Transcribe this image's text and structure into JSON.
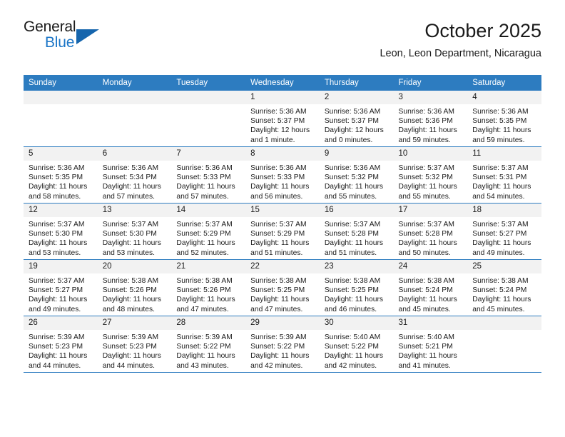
{
  "brand": {
    "name_part1": "General",
    "name_part2": "Blue",
    "accent_color": "#1c76c7",
    "triangle_color": "#1565ad"
  },
  "header": {
    "title": "October 2025",
    "subtitle": "Leon, Leon Department, Nicaragua"
  },
  "calendar": {
    "header_color": "#2d7cc0",
    "daynum_bg": "#f2f2f2",
    "weekday_headers": [
      "Sunday",
      "Monday",
      "Tuesday",
      "Wednesday",
      "Thursday",
      "Friday",
      "Saturday"
    ],
    "weeks": [
      [
        {
          "blank": true
        },
        {
          "blank": true
        },
        {
          "blank": true
        },
        {
          "day": "1",
          "sunrise": "Sunrise: 5:36 AM",
          "sunset": "Sunset: 5:37 PM",
          "daylight": "Daylight: 12 hours and 1 minute."
        },
        {
          "day": "2",
          "sunrise": "Sunrise: 5:36 AM",
          "sunset": "Sunset: 5:37 PM",
          "daylight": "Daylight: 12 hours and 0 minutes."
        },
        {
          "day": "3",
          "sunrise": "Sunrise: 5:36 AM",
          "sunset": "Sunset: 5:36 PM",
          "daylight": "Daylight: 11 hours and 59 minutes."
        },
        {
          "day": "4",
          "sunrise": "Sunrise: 5:36 AM",
          "sunset": "Sunset: 5:35 PM",
          "daylight": "Daylight: 11 hours and 59 minutes."
        }
      ],
      [
        {
          "day": "5",
          "sunrise": "Sunrise: 5:36 AM",
          "sunset": "Sunset: 5:35 PM",
          "daylight": "Daylight: 11 hours and 58 minutes."
        },
        {
          "day": "6",
          "sunrise": "Sunrise: 5:36 AM",
          "sunset": "Sunset: 5:34 PM",
          "daylight": "Daylight: 11 hours and 57 minutes."
        },
        {
          "day": "7",
          "sunrise": "Sunrise: 5:36 AM",
          "sunset": "Sunset: 5:33 PM",
          "daylight": "Daylight: 11 hours and 57 minutes."
        },
        {
          "day": "8",
          "sunrise": "Sunrise: 5:36 AM",
          "sunset": "Sunset: 5:33 PM",
          "daylight": "Daylight: 11 hours and 56 minutes."
        },
        {
          "day": "9",
          "sunrise": "Sunrise: 5:36 AM",
          "sunset": "Sunset: 5:32 PM",
          "daylight": "Daylight: 11 hours and 55 minutes."
        },
        {
          "day": "10",
          "sunrise": "Sunrise: 5:37 AM",
          "sunset": "Sunset: 5:32 PM",
          "daylight": "Daylight: 11 hours and 55 minutes."
        },
        {
          "day": "11",
          "sunrise": "Sunrise: 5:37 AM",
          "sunset": "Sunset: 5:31 PM",
          "daylight": "Daylight: 11 hours and 54 minutes."
        }
      ],
      [
        {
          "day": "12",
          "sunrise": "Sunrise: 5:37 AM",
          "sunset": "Sunset: 5:30 PM",
          "daylight": "Daylight: 11 hours and 53 minutes."
        },
        {
          "day": "13",
          "sunrise": "Sunrise: 5:37 AM",
          "sunset": "Sunset: 5:30 PM",
          "daylight": "Daylight: 11 hours and 53 minutes."
        },
        {
          "day": "14",
          "sunrise": "Sunrise: 5:37 AM",
          "sunset": "Sunset: 5:29 PM",
          "daylight": "Daylight: 11 hours and 52 minutes."
        },
        {
          "day": "15",
          "sunrise": "Sunrise: 5:37 AM",
          "sunset": "Sunset: 5:29 PM",
          "daylight": "Daylight: 11 hours and 51 minutes."
        },
        {
          "day": "16",
          "sunrise": "Sunrise: 5:37 AM",
          "sunset": "Sunset: 5:28 PM",
          "daylight": "Daylight: 11 hours and 51 minutes."
        },
        {
          "day": "17",
          "sunrise": "Sunrise: 5:37 AM",
          "sunset": "Sunset: 5:28 PM",
          "daylight": "Daylight: 11 hours and 50 minutes."
        },
        {
          "day": "18",
          "sunrise": "Sunrise: 5:37 AM",
          "sunset": "Sunset: 5:27 PM",
          "daylight": "Daylight: 11 hours and 49 minutes."
        }
      ],
      [
        {
          "day": "19",
          "sunrise": "Sunrise: 5:37 AM",
          "sunset": "Sunset: 5:27 PM",
          "daylight": "Daylight: 11 hours and 49 minutes."
        },
        {
          "day": "20",
          "sunrise": "Sunrise: 5:38 AM",
          "sunset": "Sunset: 5:26 PM",
          "daylight": "Daylight: 11 hours and 48 minutes."
        },
        {
          "day": "21",
          "sunrise": "Sunrise: 5:38 AM",
          "sunset": "Sunset: 5:26 PM",
          "daylight": "Daylight: 11 hours and 47 minutes."
        },
        {
          "day": "22",
          "sunrise": "Sunrise: 5:38 AM",
          "sunset": "Sunset: 5:25 PM",
          "daylight": "Daylight: 11 hours and 47 minutes."
        },
        {
          "day": "23",
          "sunrise": "Sunrise: 5:38 AM",
          "sunset": "Sunset: 5:25 PM",
          "daylight": "Daylight: 11 hours and 46 minutes."
        },
        {
          "day": "24",
          "sunrise": "Sunrise: 5:38 AM",
          "sunset": "Sunset: 5:24 PM",
          "daylight": "Daylight: 11 hours and 45 minutes."
        },
        {
          "day": "25",
          "sunrise": "Sunrise: 5:38 AM",
          "sunset": "Sunset: 5:24 PM",
          "daylight": "Daylight: 11 hours and 45 minutes."
        }
      ],
      [
        {
          "day": "26",
          "sunrise": "Sunrise: 5:39 AM",
          "sunset": "Sunset: 5:23 PM",
          "daylight": "Daylight: 11 hours and 44 minutes."
        },
        {
          "day": "27",
          "sunrise": "Sunrise: 5:39 AM",
          "sunset": "Sunset: 5:23 PM",
          "daylight": "Daylight: 11 hours and 44 minutes."
        },
        {
          "day": "28",
          "sunrise": "Sunrise: 5:39 AM",
          "sunset": "Sunset: 5:22 PM",
          "daylight": "Daylight: 11 hours and 43 minutes."
        },
        {
          "day": "29",
          "sunrise": "Sunrise: 5:39 AM",
          "sunset": "Sunset: 5:22 PM",
          "daylight": "Daylight: 11 hours and 42 minutes."
        },
        {
          "day": "30",
          "sunrise": "Sunrise: 5:40 AM",
          "sunset": "Sunset: 5:22 PM",
          "daylight": "Daylight: 11 hours and 42 minutes."
        },
        {
          "day": "31",
          "sunrise": "Sunrise: 5:40 AM",
          "sunset": "Sunset: 5:21 PM",
          "daylight": "Daylight: 11 hours and 41 minutes."
        },
        {
          "blank": true
        }
      ]
    ]
  }
}
